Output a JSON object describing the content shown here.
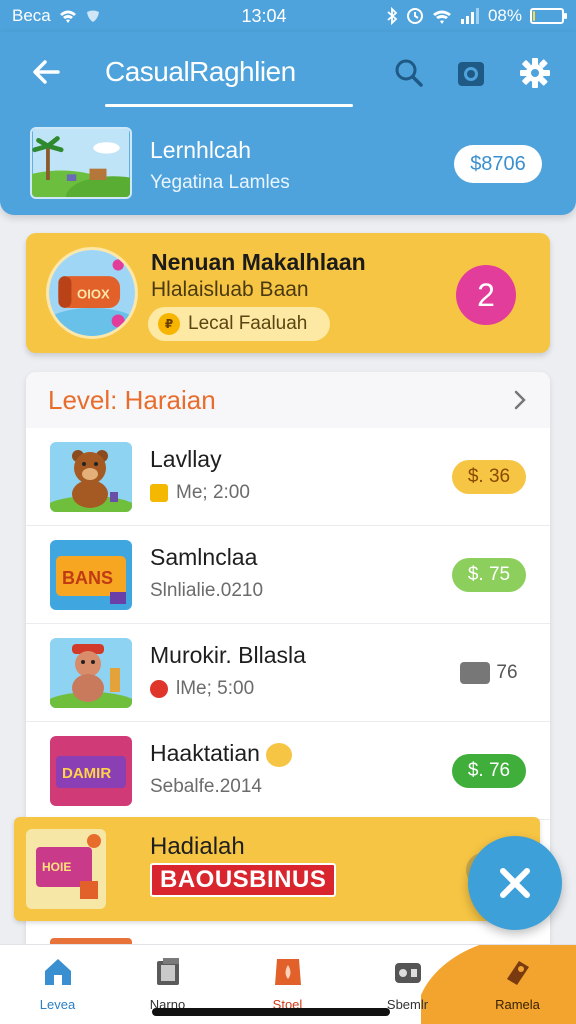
{
  "status_bar": {
    "carrier": "Beca",
    "time": "13:04",
    "battery": "08%",
    "battery_level": 0.08
  },
  "header": {
    "title": "CasualRaghlien",
    "icons": [
      "back-arrow-icon",
      "search-icon",
      "camera-icon",
      "gear-icon"
    ]
  },
  "profile": {
    "name": "Lernhlcah",
    "subtitle": "Yegatina Lamles",
    "balance": "$8706"
  },
  "featured": {
    "title": "Nenuan Makalhlaan",
    "subtitle": "Hlalaisluab Baan",
    "badge": "Lecal Faaluah",
    "count": "2"
  },
  "list": {
    "header": "Level: Haraian",
    "items": [
      {
        "name": "Lavllay",
        "meta": "Me; 2:00",
        "price": "$. 36",
        "price_style": "yellow"
      },
      {
        "name": "Samlnclaa",
        "meta": "Slnlialie.0210",
        "price": "$. 75",
        "price_style": "green-light"
      },
      {
        "name": "Murokir. Bllasla",
        "meta": "lMe; 5:00",
        "price": "76",
        "price_style": "plain"
      },
      {
        "name": "Haaktatian",
        "meta": "Sebalfe.2014",
        "price": "$. 76",
        "price_style": "green"
      }
    ],
    "bonus": {
      "name": "Hadialah",
      "label": "BAOUSBINUS"
    }
  },
  "nav": [
    {
      "label": "Levea",
      "icon": "home-icon"
    },
    {
      "label": "Narno",
      "icon": "book-icon"
    },
    {
      "label": "Stoel",
      "icon": "store-icon"
    },
    {
      "label": "Sbemlr",
      "icon": "controller-icon"
    },
    {
      "label": "Ramela",
      "icon": "ticket-icon"
    }
  ],
  "colors": {
    "primary": "#4ea3dc",
    "featured": "#f6c544",
    "accent": "#e33d9b",
    "list_header": "#e86d2c"
  }
}
